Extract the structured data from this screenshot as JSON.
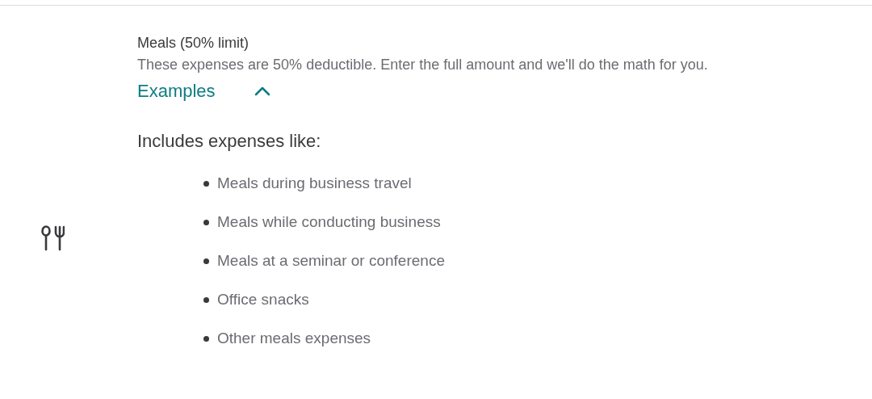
{
  "category": {
    "title": "Meals (50% limit)",
    "description": "These expenses are 50% deductible. Enter the full amount and we'll do the math for you."
  },
  "examples": {
    "label": "Examples",
    "expanded": true,
    "intro": "Includes expenses like:",
    "items": [
      "Meals during business travel",
      "Meals while conducting business",
      "Meals at a seminar or conference",
      "Office snacks",
      "Other meals expenses"
    ]
  }
}
